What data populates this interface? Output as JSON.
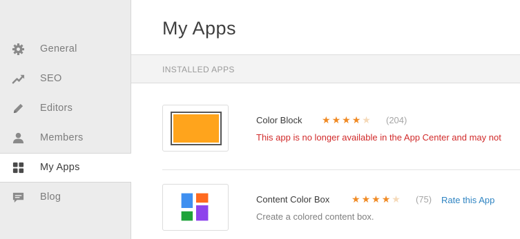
{
  "sidebar": {
    "items": [
      {
        "label": "General",
        "icon": "gear-icon",
        "active": false
      },
      {
        "label": "SEO",
        "icon": "trend-icon",
        "active": false
      },
      {
        "label": "Editors",
        "icon": "pencil-icon",
        "active": false
      },
      {
        "label": "Members",
        "icon": "person-icon",
        "active": false
      },
      {
        "label": "My Apps",
        "icon": "grid-icon",
        "active": true
      },
      {
        "label": "Blog",
        "icon": "comment-icon",
        "active": false
      }
    ]
  },
  "main": {
    "title": "My Apps",
    "section_label": "INSTALLED APPS",
    "apps": [
      {
        "name": "Color Block",
        "rating": 4,
        "max_rating": 5,
        "count": "(204)",
        "warning": "This app is no longer available in the App Center and may not"
      },
      {
        "name": "Content Color Box",
        "rating": 4,
        "max_rating": 5,
        "count": "(75)",
        "rate_link": "Rate this App",
        "description": "Create a colored content box."
      }
    ]
  },
  "colors": {
    "accent_orange": "#f08a24",
    "warning_red": "#d12a2a",
    "link_blue": "#2f84c2",
    "thumb_orange": "#ffa41c"
  }
}
